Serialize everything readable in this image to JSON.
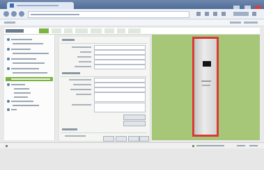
{
  "browser": {
    "window_controls": [
      "minimize",
      "maximize",
      "close"
    ],
    "tab_icon": "page-icon"
  },
  "toolbar": {
    "icons": [
      "back-icon",
      "forward-icon",
      "reload-icon",
      "star-icon",
      "home-icon",
      "menu-icon"
    ]
  },
  "app": {
    "logo_icon": "app-logo",
    "active_color": "#7cb342",
    "preview_background": "#a7c778",
    "device_border_color": "#d93a36"
  }
}
